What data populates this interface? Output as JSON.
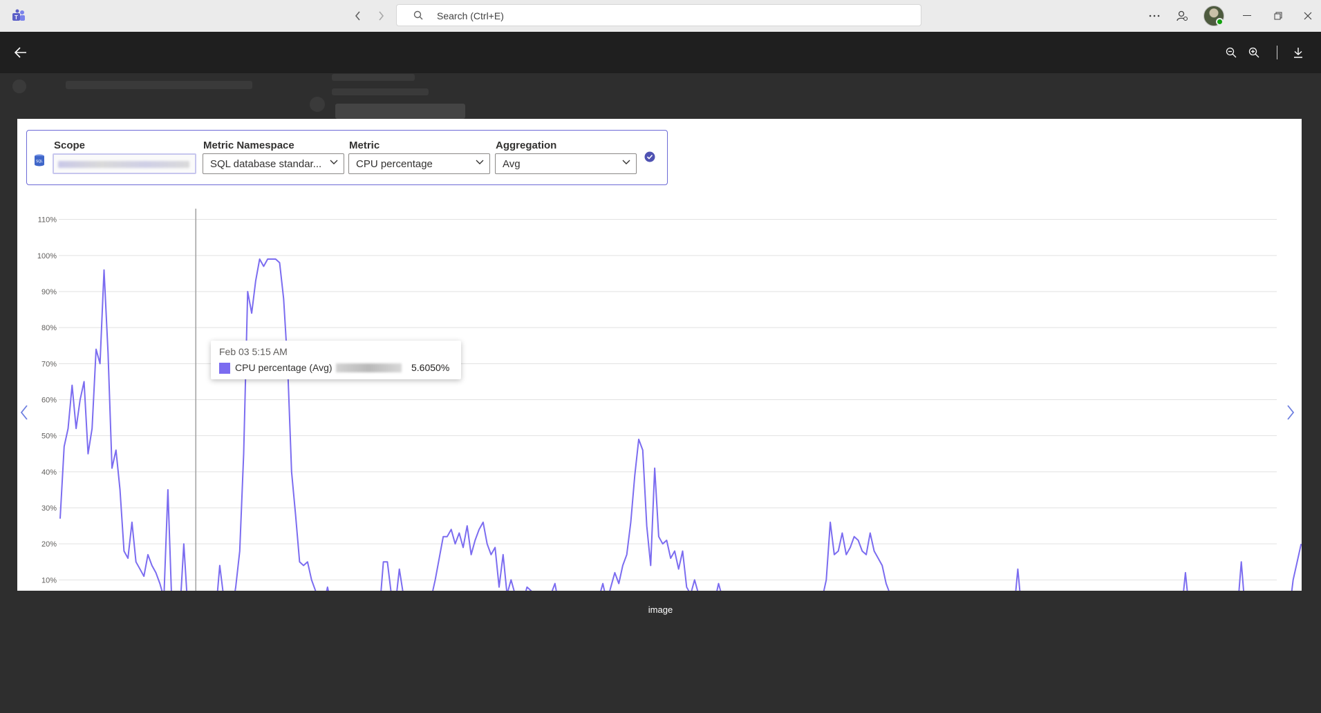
{
  "titlebar": {
    "search_placeholder": "Search (Ctrl+E)"
  },
  "controls": {
    "scope_label": "Scope",
    "namespace_label": "Metric Namespace",
    "namespace_value": "SQL database standar...",
    "metric_label": "Metric",
    "metric_value": "CPU percentage",
    "aggregation_label": "Aggregation",
    "aggregation_value": "Avg"
  },
  "tooltip": {
    "time": "Feb 03 5:15 AM",
    "series_label": "CPU percentage (Avg)",
    "value": "5.6050%"
  },
  "caption": "image",
  "chart_data": {
    "type": "line",
    "color": "#7b6cf0",
    "y_ticks": [
      "10%",
      "20%",
      "30%",
      "40%",
      "50%",
      "60%",
      "70%",
      "80%",
      "90%",
      "100%",
      "110%"
    ],
    "ylim": [
      7,
      113
    ],
    "x_points": 300,
    "series": [
      {
        "values": [
          27,
          47,
          52,
          64,
          52,
          60,
          65,
          45,
          52,
          74,
          70,
          96,
          73,
          41,
          46,
          35,
          18,
          16,
          26,
          15,
          13,
          11,
          17,
          14,
          12,
          9,
          5,
          35,
          3,
          2,
          1,
          20,
          2,
          1,
          1,
          1,
          1,
          1,
          1,
          1,
          14,
          5,
          1,
          1,
          8,
          18,
          45,
          90,
          84,
          93,
          99,
          97,
          99,
          99,
          99,
          98,
          88,
          70,
          40,
          28,
          15,
          14,
          15,
          10,
          7,
          5,
          3,
          8,
          3,
          2,
          3,
          6,
          3,
          1,
          2,
          1,
          1,
          1,
          1,
          1,
          1,
          15,
          15,
          6,
          3,
          13,
          6,
          2,
          1,
          1,
          1,
          1,
          2,
          5,
          10,
          16,
          22,
          22,
          24,
          20,
          23,
          19,
          25,
          17,
          21,
          24,
          26,
          20,
          17,
          19,
          8,
          17,
          6,
          10,
          6,
          5,
          4,
          8,
          7,
          5,
          5,
          6,
          4,
          6,
          9,
          3,
          2,
          4,
          2,
          1,
          1,
          1,
          1,
          1,
          1,
          5,
          9,
          4,
          8,
          12,
          9,
          14,
          17,
          26,
          39,
          49,
          46,
          25,
          14,
          41,
          22,
          20,
          21,
          16,
          18,
          13,
          18,
          8,
          6,
          10,
          6,
          5,
          2,
          5,
          4,
          9,
          5,
          4,
          4,
          1,
          1,
          1,
          1,
          1,
          1,
          1,
          1,
          1,
          1,
          1,
          1,
          1,
          1,
          1,
          1,
          1,
          1,
          1,
          1,
          1,
          1,
          5,
          10,
          26,
          17,
          18,
          23,
          17,
          19,
          22,
          21,
          18,
          17,
          23,
          18,
          16,
          14,
          9,
          6,
          5,
          3,
          2,
          1,
          1,
          1,
          1,
          1,
          1,
          1,
          1,
          1,
          1,
          1,
          1,
          1,
          1,
          1,
          1,
          1,
          1,
          1,
          1,
          1,
          1,
          1,
          1,
          1,
          1,
          1,
          1,
          13,
          1,
          1,
          1,
          1,
          1,
          1,
          1,
          1,
          1,
          1,
          1,
          1,
          1,
          1,
          1,
          1,
          1,
          1,
          1,
          1,
          1,
          1,
          1,
          1,
          1,
          1,
          1,
          1,
          1,
          1,
          1,
          1,
          1,
          1,
          1,
          1,
          1,
          1,
          1,
          1,
          1,
          12,
          1,
          1,
          1,
          1,
          1,
          1,
          1,
          1,
          1,
          1,
          1,
          1,
          1,
          15,
          1,
          1,
          1,
          1,
          1,
          1,
          1,
          1,
          1,
          1,
          1,
          1,
          10,
          15,
          20
        ]
      }
    ],
    "crosshair_index": 34
  }
}
